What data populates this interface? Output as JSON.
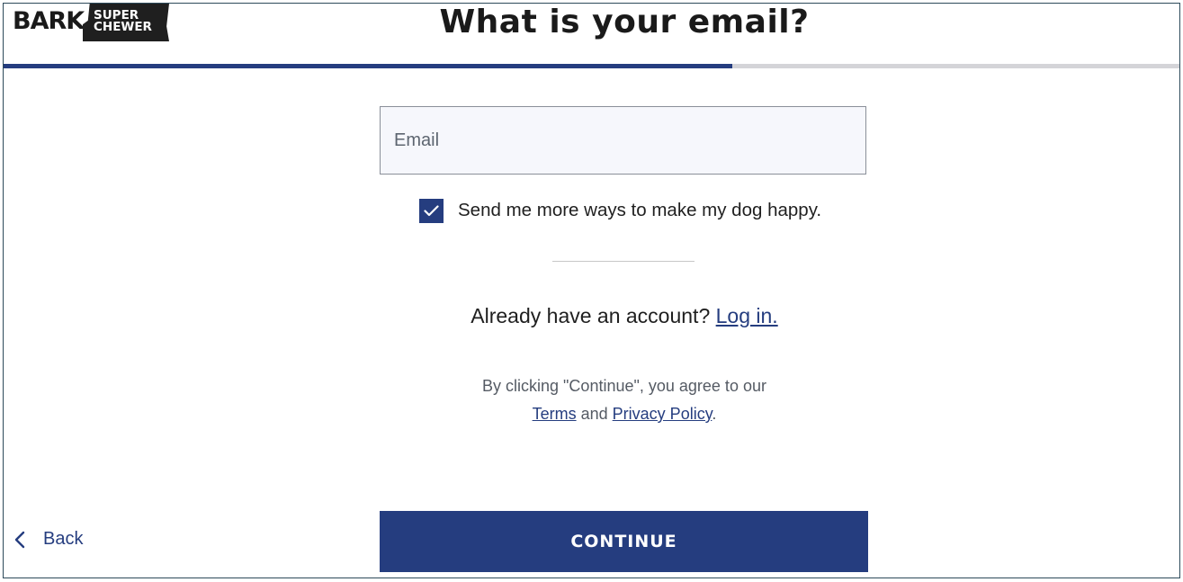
{
  "header": {
    "logo": {
      "bark": "BARK",
      "line1": "SUPER",
      "line2": "CHEWER"
    },
    "title": "What is your email?",
    "progress": 0.62
  },
  "form": {
    "email_placeholder": "Email",
    "email_value": "",
    "newsletter_checked": true,
    "newsletter_label": "Send me more ways to make my dog happy."
  },
  "account": {
    "prompt": "Already have an account?",
    "login_label": "Log in."
  },
  "legal": {
    "line1": "By clicking \"Continue\", you agree to our",
    "terms_label": "Terms",
    "and_text": "and",
    "privacy_label": "Privacy Policy",
    "period": "."
  },
  "footer": {
    "back_label": "Back",
    "continue_label": "CONTINUE"
  },
  "colors": {
    "accent": "#253d7f",
    "track": "#d4d4d8",
    "input_bg": "#f6f7fc"
  }
}
